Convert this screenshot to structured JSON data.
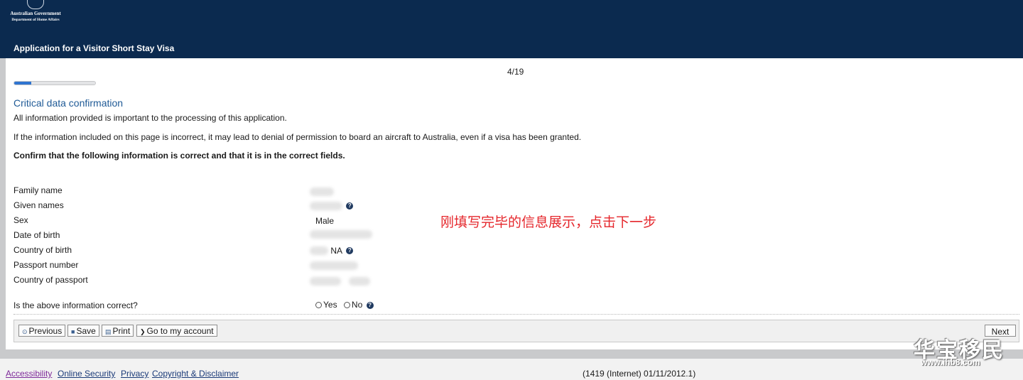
{
  "header": {
    "logo_line1": "Australian Government",
    "logo_line2": "Department of Home Affairs",
    "app_title": "Application for a Visitor Short Stay Visa"
  },
  "progress": {
    "step_text": "4/19",
    "fraction": 0.21
  },
  "section": {
    "title": "Critical data confirmation",
    "para1": "All information provided is important to the processing of this application.",
    "para2": "If the information included on this page is incorrect, it may lead to denial of permission to board an aircraft to Australia, even if a visa has been granted.",
    "para3": "Confirm that the following information is correct and that it is in the correct fields."
  },
  "fields": {
    "family_name": {
      "label": "Family name"
    },
    "given_names": {
      "label": "Given names"
    },
    "sex": {
      "label": "Sex",
      "value": "Male"
    },
    "dob": {
      "label": "Date of birth"
    },
    "country_birth": {
      "label": "Country of birth",
      "value": "NA"
    },
    "passport_number": {
      "label": "Passport number"
    },
    "country_passport": {
      "label": "Country of passport"
    }
  },
  "question": {
    "label": "Is the above information correct?",
    "yes": "Yes",
    "no": "No"
  },
  "toolbar": {
    "previous": "Previous",
    "save": "Save",
    "print": "Print",
    "account": "Go to my account",
    "next": "Next"
  },
  "annotation": "刚填写完毕的信息展示，点击下一步",
  "footer": {
    "accessibility": "Accessibility",
    "online_security": "Online Security",
    "privacy": "Privacy",
    "copyright": "Copyright & Disclaimer",
    "version": "(1419 (Internet) 01/11/2012.1)"
  },
  "watermark": {
    "text": "华宝移民",
    "url": "www.ihb8.com"
  },
  "colors": {
    "header_bg": "#0b2a4f",
    "section_title": "#1f5a96",
    "progress_fill": "#2f74d0",
    "annotation": "#e5262b"
  }
}
